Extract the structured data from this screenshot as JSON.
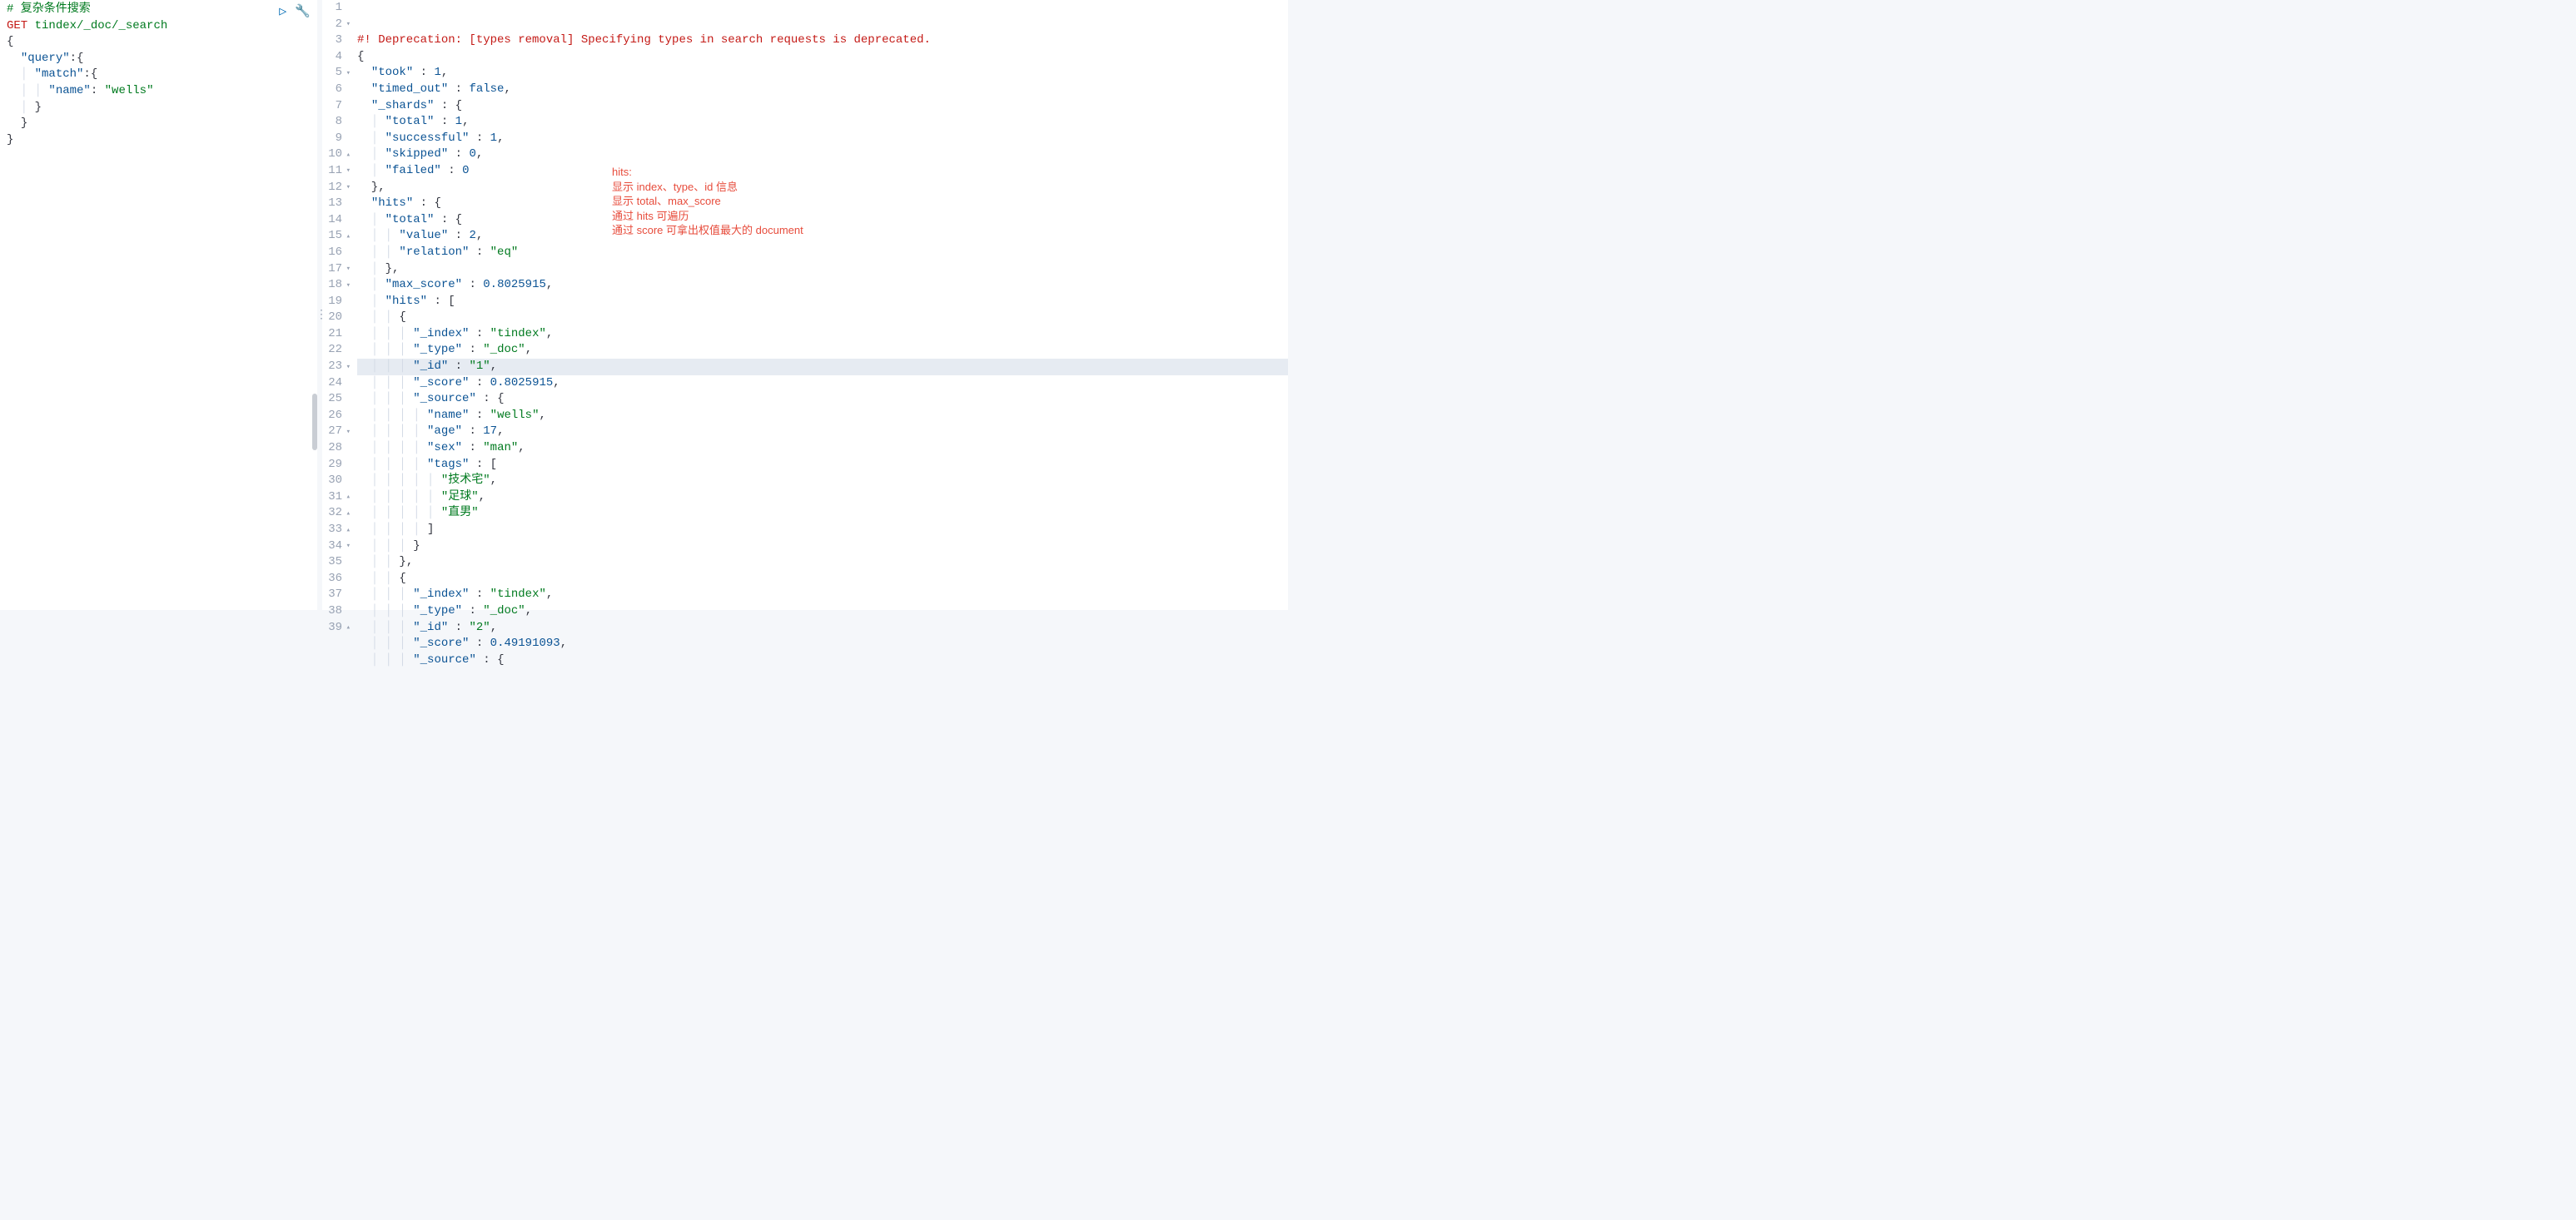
{
  "left": {
    "comment": "# 复杂条件搜索",
    "method": "GET",
    "path": " tindex/_doc/_search",
    "body_lines": [
      "{",
      "  \"query\":{",
      "    \"match\":{",
      "      \"name\": \"wells\"",
      "    }",
      "  }",
      "}"
    ]
  },
  "icons": {
    "play": "▷",
    "wrench": "🔧"
  },
  "right": {
    "deprecation": "#! Deprecation: [types removal] Specifying types in search requests is deprecated.",
    "line_numbers": [
      "1",
      "2",
      "3",
      "4",
      "5",
      "6",
      "7",
      "8",
      "9",
      "10",
      "11",
      "12",
      "13",
      "14",
      "15",
      "16",
      "17",
      "18",
      "19",
      "20",
      "21",
      "22",
      "23",
      "24",
      "25",
      "26",
      "27",
      "28",
      "29",
      "30",
      "31",
      "32",
      "33",
      "34",
      "35",
      "36",
      "37",
      "38",
      "39"
    ],
    "folds": [
      "",
      "▾",
      "",
      "",
      "▾",
      "",
      "",
      "",
      "",
      "▴",
      "▾",
      "▾",
      "",
      "",
      "▴",
      "",
      "▾",
      "▾",
      "",
      "",
      "",
      "",
      "▾",
      "",
      "",
      "",
      "▾",
      "",
      "",
      "",
      "▴",
      "▴",
      "▴",
      "▾",
      "",
      "",
      "",
      "",
      "▴"
    ],
    "highlight_index": 20,
    "lines": {
      "l2": "{",
      "l3_k": "\"took\"",
      "l3_v": "1",
      "l4_k": "\"timed_out\"",
      "l4_v": "false",
      "l5_k": "\"_shards\"",
      "l6_k": "\"total\"",
      "l6_v": "1",
      "l7_k": "\"successful\"",
      "l7_v": "1",
      "l8_k": "\"skipped\"",
      "l8_v": "0",
      "l9_k": "\"failed\"",
      "l9_v": "0",
      "l10": "},",
      "l11_k": "\"hits\"",
      "l12_k": "\"total\"",
      "l13_k": "\"value\"",
      "l13_v": "2",
      "l14_k": "\"relation\"",
      "l14_v": "\"eq\"",
      "l15": "},",
      "l16_k": "\"max_score\"",
      "l16_v": "0.8025915",
      "l17_k": "\"hits\"",
      "l18": "{",
      "l19_k": "\"_index\"",
      "l19_v": "\"tindex\"",
      "l20_k": "\"_type\"",
      "l20_v": "\"_doc\"",
      "l21_k": "\"_id\"",
      "l21_v": "\"1\"",
      "l22_k": "\"_score\"",
      "l22_v": "0.8025915",
      "l23_k": "\"_source\"",
      "l24_k": "\"name\"",
      "l24_v": "\"wells\"",
      "l25_k": "\"age\"",
      "l25_v": "17",
      "l26_k": "\"sex\"",
      "l26_v": "\"man\"",
      "l27_k": "\"tags\"",
      "l28": "\"技术宅\"",
      "l29": "\"足球\"",
      "l30": "\"直男\"",
      "l31": "]",
      "l32": "}",
      "l33": "},",
      "l34": "{",
      "l35_k": "\"_index\"",
      "l35_v": "\"tindex\"",
      "l36_k": "\"_type\"",
      "l36_v": "\"_doc\"",
      "l37_k": "\"_id\"",
      "l37_v": "\"2\"",
      "l38_k": "\"_score\"",
      "l38_v": "0.49191093",
      "l39_k": "\"_source\""
    }
  },
  "annotation": {
    "l1": "hits:",
    "l2": "显示 index、type、id 信息",
    "l3": "显示 total、max_score",
    "l4": "通过 hits 可遍历",
    "l5": "通过 score 可拿出权值最大的 document"
  }
}
